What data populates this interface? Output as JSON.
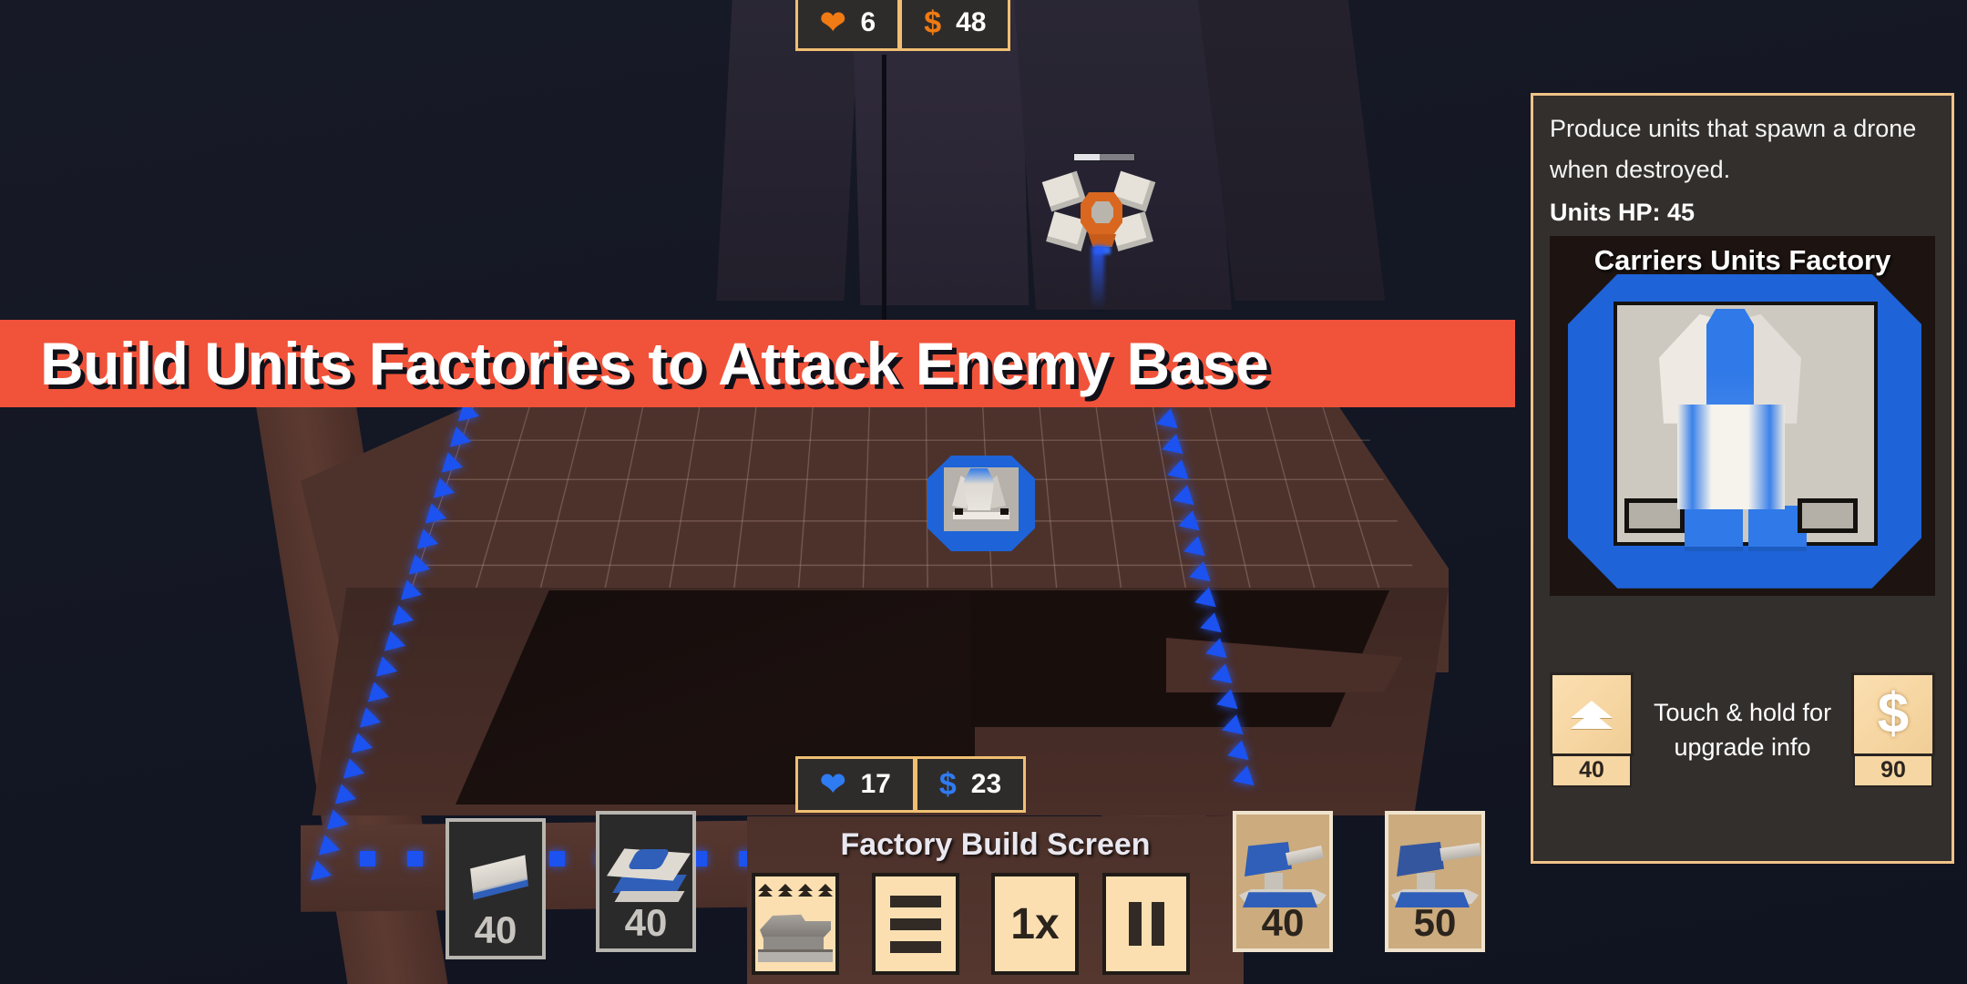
{
  "hud": {
    "top": {
      "health_icon": "heart-icon",
      "health_value": "6",
      "money_icon": "dollar-icon",
      "money_value": "48"
    },
    "bottom": {
      "health_icon": "heart-icon",
      "health_value": "17",
      "money_icon": "dollar-icon",
      "money_value": "23"
    }
  },
  "banner": {
    "text": "Build Units Factories to Attack Enemy Base",
    "background": "#f0533a",
    "text_color": "#ffffff"
  },
  "info_panel": {
    "description": "Produce units that spawn a drone when destroyed.",
    "units_hp_label": "Units HP: 45",
    "card_title": "Carriers Units Factory",
    "upgrade_button": {
      "icon": "double-chevron-up-icon",
      "cost": "40"
    },
    "sell_button": {
      "icon": "dollar-icon",
      "cost": "90"
    },
    "hold_hint": "Touch & hold for upgrade info",
    "border_color": "#f0c388",
    "background": "#332f2c"
  },
  "build_bar": {
    "title": "Factory Build Screen",
    "left_cards": [
      {
        "icon": "unit-factory-small-icon",
        "cost": "40"
      },
      {
        "icon": "unit-factory-wide-icon",
        "cost": "40"
      }
    ],
    "right_cards": [
      {
        "icon": "turret-cannon-icon",
        "cost": "40"
      },
      {
        "icon": "turret-heavy-icon",
        "cost": "50"
      }
    ],
    "tools": [
      {
        "name": "turret-upgrade-button",
        "icon": "turret-upgrade-icon",
        "label": ""
      },
      {
        "name": "menu-button",
        "icon": "hamburger-icon",
        "label": ""
      },
      {
        "name": "speed-button",
        "icon": "speed-icon",
        "label": "1x"
      },
      {
        "name": "pause-button",
        "icon": "pause-icon",
        "label": ""
      }
    ]
  },
  "map": {
    "enemy_unit": "enemy-mech-unit",
    "player_factory": "player-carrier-factory",
    "path_marker": "blue-arrow-waypoint"
  },
  "colors": {
    "accent_gold": "#f0c388",
    "player_blue": "#1f63d8",
    "enemy_orange": "#f07a13",
    "banner_red": "#f0533a",
    "terrain_brown": "#4d322c"
  }
}
